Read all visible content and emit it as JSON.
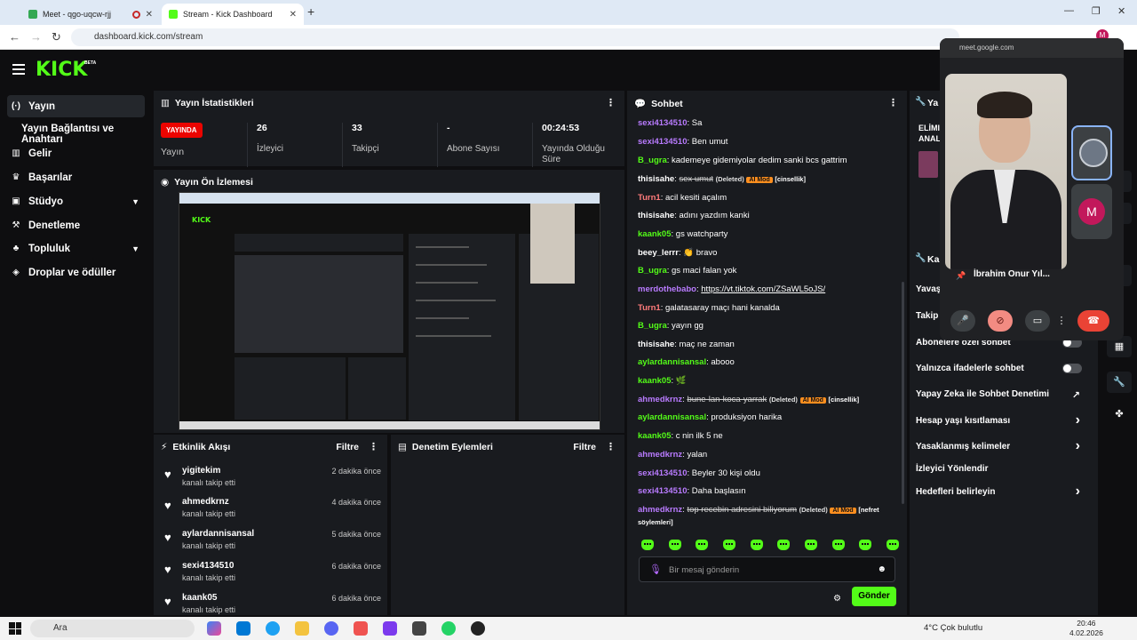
{
  "browser": {
    "tabs": [
      {
        "title": "Meet - qgo-uqcw-rjj",
        "icon": "meet-icon"
      },
      {
        "title": "Stream - Kick Dashboard",
        "icon": "kick-icon"
      }
    ],
    "url": "dashboard.kick.com/stream"
  },
  "header": {
    "logo": "KICK",
    "beta": "BETA"
  },
  "sidebar": {
    "items": [
      {
        "label": "Yayın",
        "icon": "broadcast-icon"
      },
      {
        "label": "Yayın Bağlantısı ve Anahtarı"
      },
      {
        "label": "Gelir",
        "icon": "chart-icon"
      },
      {
        "label": "Başarılar",
        "icon": "trophy-icon"
      },
      {
        "label": "Stüdyo",
        "icon": "studio-icon"
      },
      {
        "label": "Denetleme",
        "icon": "hammer-icon"
      },
      {
        "label": "Topluluk",
        "icon": "community-icon"
      },
      {
        "label": "Droplar ve ödüller",
        "icon": "drops-icon"
      }
    ]
  },
  "stats": {
    "title": "Yayın İstatistikleri",
    "live_badge": "YAYINDA",
    "live_label": "Yayın",
    "items": [
      {
        "value": "26",
        "label": "İzleyici"
      },
      {
        "value": "33",
        "label": "Takipçi"
      },
      {
        "value": "-",
        "label": "Abone Sayısı"
      },
      {
        "value": "00:24:53",
        "label": "Yayında Olduğu Süre"
      }
    ]
  },
  "preview": {
    "title": "Yayın Ön İzlemesi"
  },
  "events": {
    "title": "Etkinlik Akışı",
    "filter": "Filtre",
    "rows": [
      {
        "name": "yigitekim",
        "sub": "kanalı takip etti",
        "time": "2 dakika önce"
      },
      {
        "name": "ahmedkrnz",
        "sub": "kanalı takip etti",
        "time": "4 dakika önce"
      },
      {
        "name": "aylardannisansal",
        "sub": "kanalı takip etti",
        "time": "5 dakika önce"
      },
      {
        "name": "sexi4134510",
        "sub": "kanalı takip etti",
        "time": "6 dakika önce"
      },
      {
        "name": "kaank05",
        "sub": "kanalı takip etti",
        "time": "6 dakika önce"
      }
    ]
  },
  "mod": {
    "title": "Denetim Eylemleri",
    "filter": "Filtre"
  },
  "chat": {
    "title": "Sohbet",
    "messages": [
      {
        "user": "sexi4134510",
        "color": "#b97bff",
        "text": "Sa"
      },
      {
        "user": "sexi4134510",
        "color": "#b97bff",
        "text": "Ben umut"
      },
      {
        "user": "B_ugra",
        "color": "#53fc18",
        "text": "kademeye gidemiyolar dedim sanki bcs gattrim"
      },
      {
        "user": "thisisahe",
        "color": "#ffffff",
        "text": "sex umut",
        "deleted": "(Deleted)",
        "ai": "AI Mod",
        "tag": "[cinsellik]"
      },
      {
        "user": "Turn1",
        "color": "#ff7b7b",
        "text": "acil kesiti açalım"
      },
      {
        "user": "thisisahe",
        "color": "#ffffff",
        "text": "adını yazdım kanki"
      },
      {
        "user": "kaank05",
        "color": "#53fc18",
        "text": "gs watchparty"
      },
      {
        "user": "beey_lerrr",
        "color": "#ffffff",
        "text": "👏 bravo"
      },
      {
        "user": "B_ugra",
        "color": "#53fc18",
        "text": "gs maci falan yok"
      },
      {
        "user": "merdothebabo",
        "color": "#b97bff",
        "text": "https://vt.tiktok.com/ZSaWL5oJS/"
      },
      {
        "user": "Turn1",
        "color": "#ff7b7b",
        "text": "galatasaray maçı hani kanalda"
      },
      {
        "user": "B_ugra",
        "color": "#53fc18",
        "text": "yayın gg"
      },
      {
        "user": "thisisahe",
        "color": "#ffffff",
        "text": "maç ne zaman"
      },
      {
        "user": "aylardannisansal",
        "color": "#53fc18",
        "text": "abooo"
      },
      {
        "user": "kaank05",
        "color": "#53fc18",
        "text": "🌿"
      },
      {
        "user": "ahmedkrnz",
        "color": "#b97bff",
        "text": "bune-lan-koca-yarrak",
        "deleted": "(Deleted)",
        "ai": "AI Mod",
        "tag": "[cinsellik]"
      },
      {
        "user": "aylardannisansal",
        "color": "#53fc18",
        "text": "produksiyon harika"
      },
      {
        "user": "kaank05",
        "color": "#53fc18",
        "text": "c nin ilk 5 ne"
      },
      {
        "user": "ahmedkrnz",
        "color": "#b97bff",
        "text": "yalan"
      },
      {
        "user": "sexi4134510",
        "color": "#b97bff",
        "text": "Beyler 30 kişi oldu"
      },
      {
        "user": "sexi4134510",
        "color": "#b97bff",
        "text": "Daha başlasın"
      },
      {
        "user": "ahmedkrnz",
        "color": "#b97bff",
        "text": "top recebin adresini biliyorum",
        "deleted": "(Deleted)",
        "ai": "AI Mod",
        "tag": "[nefret söylemleri]"
      }
    ],
    "placeholder": "Bir mesaj gönderin",
    "send": "Gönder"
  },
  "settings": {
    "rows": [
      {
        "label": "Yavaş",
        "type": "cut"
      },
      {
        "label": "Takip",
        "type": "cut"
      },
      {
        "label": "Abonelere özel sohbet",
        "type": "toggle"
      },
      {
        "label": "Yalnızca ifadelerle sohbet",
        "type": "toggle"
      },
      {
        "label": "Yapay Zeka ile Sohbet Denetimi",
        "type": "external"
      },
      {
        "label": "Hesap yaşı kısıtlaması",
        "type": "chevron"
      },
      {
        "label": "Yasaklanmış kelimeler",
        "type": "chevron"
      },
      {
        "label": "İzleyici Yönlendir",
        "type": "plain"
      },
      {
        "label": "Hedefleri belirleyin",
        "type": "chevron"
      }
    ],
    "header_cut": "Ka",
    "top_cut": "Ya",
    "top_text": "ELİMI ANAL"
  },
  "meet": {
    "url": "meet.google.com",
    "participant": "İbrahim Onur Yıl...",
    "avatar_letter": "M"
  },
  "taskbar": {
    "search": "Ara",
    "weather": "4°C  Çok bulutlu",
    "time": "20:46",
    "date": "4.02.2026"
  }
}
